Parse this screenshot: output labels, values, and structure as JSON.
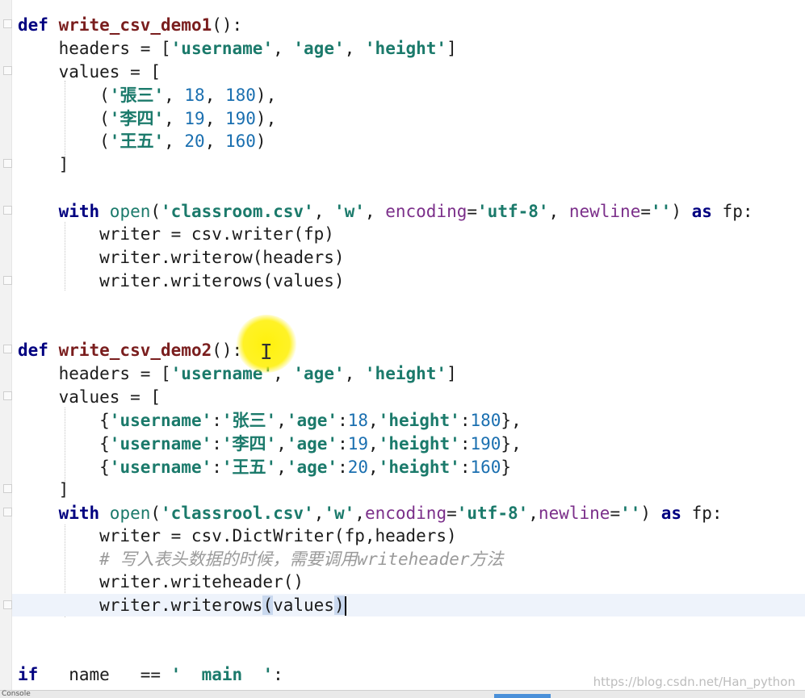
{
  "editor": {
    "lines": [
      {
        "id": "l1",
        "segments": [
          [
            "kw",
            "def "
          ],
          [
            "fn",
            "write_csv_demo1"
          ],
          [
            "plain",
            "():"
          ]
        ]
      },
      {
        "id": "l2",
        "segments": [
          [
            "plain",
            "    headers = ["
          ],
          [
            "str",
            "'username'"
          ],
          [
            "plain",
            ", "
          ],
          [
            "str",
            "'age'"
          ],
          [
            "plain",
            ", "
          ],
          [
            "str",
            "'height'"
          ],
          [
            "plain",
            "]"
          ]
        ]
      },
      {
        "id": "l3",
        "segments": [
          [
            "plain",
            "    values = ["
          ]
        ]
      },
      {
        "id": "l4",
        "segments": [
          [
            "plain",
            "        ("
          ],
          [
            "str",
            "'張三'"
          ],
          [
            "plain",
            ", "
          ],
          [
            "num",
            "18"
          ],
          [
            "plain",
            ", "
          ],
          [
            "num",
            "180"
          ],
          [
            "plain",
            "),"
          ]
        ]
      },
      {
        "id": "l5",
        "segments": [
          [
            "plain",
            "        ("
          ],
          [
            "str",
            "'李四'"
          ],
          [
            "plain",
            ", "
          ],
          [
            "num",
            "19"
          ],
          [
            "plain",
            ", "
          ],
          [
            "num",
            "190"
          ],
          [
            "plain",
            "),"
          ]
        ]
      },
      {
        "id": "l6",
        "segments": [
          [
            "plain",
            "        ("
          ],
          [
            "str",
            "'王五'"
          ],
          [
            "plain",
            ", "
          ],
          [
            "num",
            "20"
          ],
          [
            "plain",
            ", "
          ],
          [
            "num",
            "160"
          ],
          [
            "plain",
            ")"
          ]
        ]
      },
      {
        "id": "l7",
        "segments": [
          [
            "plain",
            "    ]"
          ]
        ]
      },
      {
        "id": "l8",
        "segments": []
      },
      {
        "id": "l9",
        "segments": [
          [
            "kw",
            "    with "
          ],
          [
            "builtin",
            "open"
          ],
          [
            "plain",
            "("
          ],
          [
            "str",
            "'classroom.csv'"
          ],
          [
            "plain",
            ", "
          ],
          [
            "str",
            "'w'"
          ],
          [
            "plain",
            ", "
          ],
          [
            "param",
            "encoding"
          ],
          [
            "plain",
            "="
          ],
          [
            "str",
            "'utf-8'"
          ],
          [
            "plain",
            ", "
          ],
          [
            "param",
            "newline"
          ],
          [
            "plain",
            "="
          ],
          [
            "str",
            "''"
          ],
          [
            "plain",
            ") "
          ],
          [
            "kw",
            "as"
          ],
          [
            "plain",
            " fp:"
          ]
        ]
      },
      {
        "id": "l10",
        "segments": [
          [
            "plain",
            "        writer = csv.writer(fp)"
          ]
        ]
      },
      {
        "id": "l11",
        "segments": [
          [
            "plain",
            "        writer.writerow(headers)"
          ]
        ]
      },
      {
        "id": "l12",
        "segments": [
          [
            "plain",
            "        writer.writerows(values)"
          ]
        ]
      },
      {
        "id": "l13",
        "segments": []
      },
      {
        "id": "l14",
        "segments": []
      },
      {
        "id": "l15",
        "segments": [
          [
            "kw",
            "def "
          ],
          [
            "fn",
            "write_csv_demo2"
          ],
          [
            "plain",
            "():"
          ]
        ]
      },
      {
        "id": "l16",
        "segments": [
          [
            "plain",
            "    headers = ["
          ],
          [
            "str",
            "'username'"
          ],
          [
            "plain",
            ", "
          ],
          [
            "str",
            "'age'"
          ],
          [
            "plain",
            ", "
          ],
          [
            "str",
            "'height'"
          ],
          [
            "plain",
            "]"
          ]
        ]
      },
      {
        "id": "l17",
        "segments": [
          [
            "plain",
            "    values = ["
          ]
        ]
      },
      {
        "id": "l18",
        "segments": [
          [
            "plain",
            "        {"
          ],
          [
            "str",
            "'username'"
          ],
          [
            "plain",
            ":"
          ],
          [
            "str",
            "'张三'"
          ],
          [
            "plain",
            ","
          ],
          [
            "str",
            "'age'"
          ],
          [
            "plain",
            ":"
          ],
          [
            "num",
            "18"
          ],
          [
            "plain",
            ","
          ],
          [
            "str",
            "'height'"
          ],
          [
            "plain",
            ":"
          ],
          [
            "num",
            "180"
          ],
          [
            "plain",
            "},"
          ]
        ]
      },
      {
        "id": "l19",
        "segments": [
          [
            "plain",
            "        {"
          ],
          [
            "str",
            "'username'"
          ],
          [
            "plain",
            ":"
          ],
          [
            "str",
            "'李四'"
          ],
          [
            "plain",
            ","
          ],
          [
            "str",
            "'age'"
          ],
          [
            "plain",
            ":"
          ],
          [
            "num",
            "19"
          ],
          [
            "plain",
            ","
          ],
          [
            "str",
            "'height'"
          ],
          [
            "plain",
            ":"
          ],
          [
            "num",
            "190"
          ],
          [
            "plain",
            "},"
          ]
        ]
      },
      {
        "id": "l20",
        "segments": [
          [
            "plain",
            "        {"
          ],
          [
            "str",
            "'username'"
          ],
          [
            "plain",
            ":"
          ],
          [
            "str",
            "'王五'"
          ],
          [
            "plain",
            ","
          ],
          [
            "str",
            "'age'"
          ],
          [
            "plain",
            ":"
          ],
          [
            "num",
            "20"
          ],
          [
            "plain",
            ","
          ],
          [
            "str",
            "'height'"
          ],
          [
            "plain",
            ":"
          ],
          [
            "num",
            "160"
          ],
          [
            "plain",
            "}"
          ]
        ]
      },
      {
        "id": "l21",
        "segments": [
          [
            "plain",
            "    ]"
          ]
        ]
      },
      {
        "id": "l22",
        "segments": [
          [
            "kw",
            "    with "
          ],
          [
            "builtin",
            "open"
          ],
          [
            "plain",
            "("
          ],
          [
            "str",
            "'classrool.csv'"
          ],
          [
            "plain",
            ","
          ],
          [
            "str",
            "'w'"
          ],
          [
            "plain",
            ","
          ],
          [
            "param",
            "encoding"
          ],
          [
            "plain",
            "="
          ],
          [
            "str",
            "'utf-8'"
          ],
          [
            "plain",
            ","
          ],
          [
            "param",
            "newline"
          ],
          [
            "plain",
            "="
          ],
          [
            "str",
            "''"
          ],
          [
            "plain",
            ") "
          ],
          [
            "kw",
            "as"
          ],
          [
            "plain",
            " fp:"
          ]
        ]
      },
      {
        "id": "l23",
        "segments": [
          [
            "plain",
            "        writer = csv.DictWriter(fp,headers)"
          ]
        ]
      },
      {
        "id": "l24",
        "segments": [
          [
            "comment",
            "        # 写入表头数据的时候，需要调用writeheader方法"
          ]
        ]
      },
      {
        "id": "l25",
        "segments": [
          [
            "plain",
            "        writer.writeheader()"
          ]
        ]
      },
      {
        "id": "l26",
        "segments": [
          [
            "plain",
            "        writer.writerows"
          ],
          [
            "paren",
            "("
          ],
          [
            "plain",
            "values"
          ],
          [
            "paren",
            ")"
          ],
          [
            "caret",
            ""
          ]
        ]
      },
      {
        "id": "l27",
        "segments": []
      },
      {
        "id": "l28",
        "segments": []
      },
      {
        "id": "l29",
        "segments": [
          [
            "kw",
            "if "
          ],
          [
            "plain",
            "  name   == "
          ],
          [
            "str",
            "'  main  '"
          ],
          [
            "plain",
            ":"
          ]
        ]
      }
    ]
  },
  "statusbar": {
    "tab_label": "Console"
  },
  "watermark": {
    "text": "https://blog.csdn.net/Han_python"
  },
  "colors": {
    "keyword": "#000080",
    "function_name": "#7a1e1e",
    "string": "#1b7a6b",
    "number": "#1a6fb0",
    "parameter": "#7b2f8a",
    "comment": "#9a9a9a",
    "current_line": "#eef3fb",
    "cursor_highlight": "#fff000"
  }
}
